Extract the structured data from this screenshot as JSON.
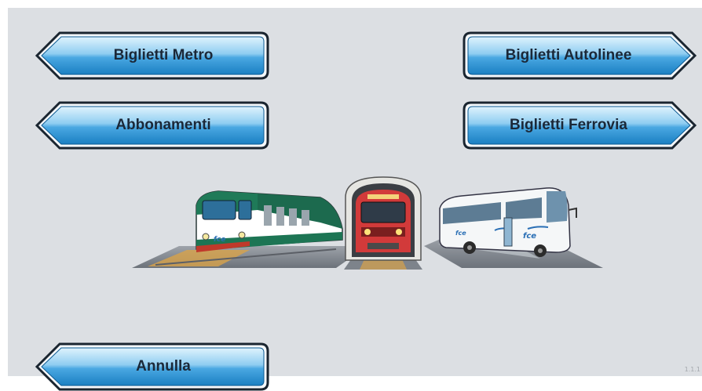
{
  "buttons": {
    "metro": "Biglietti Metro",
    "abbonamenti": "Abbonamenti",
    "autolinee": "Biglietti Autolinee",
    "ferrovia": "Biglietti Ferrovia",
    "annulla": "Annulla"
  },
  "illustration": {
    "logo_text": "fce"
  },
  "footer": {
    "corner_text": "1.1.1"
  },
  "colors": {
    "background": "#dcdfe3",
    "button_top": "#c8e8fa",
    "button_bottom": "#1e86c8",
    "button_border": "#1a2530",
    "button_text": "#1b2838"
  },
  "icons": [
    "left-arrow-button-shape",
    "right-arrow-button-shape",
    "train-icon",
    "metro-icon",
    "bus-icon"
  ]
}
